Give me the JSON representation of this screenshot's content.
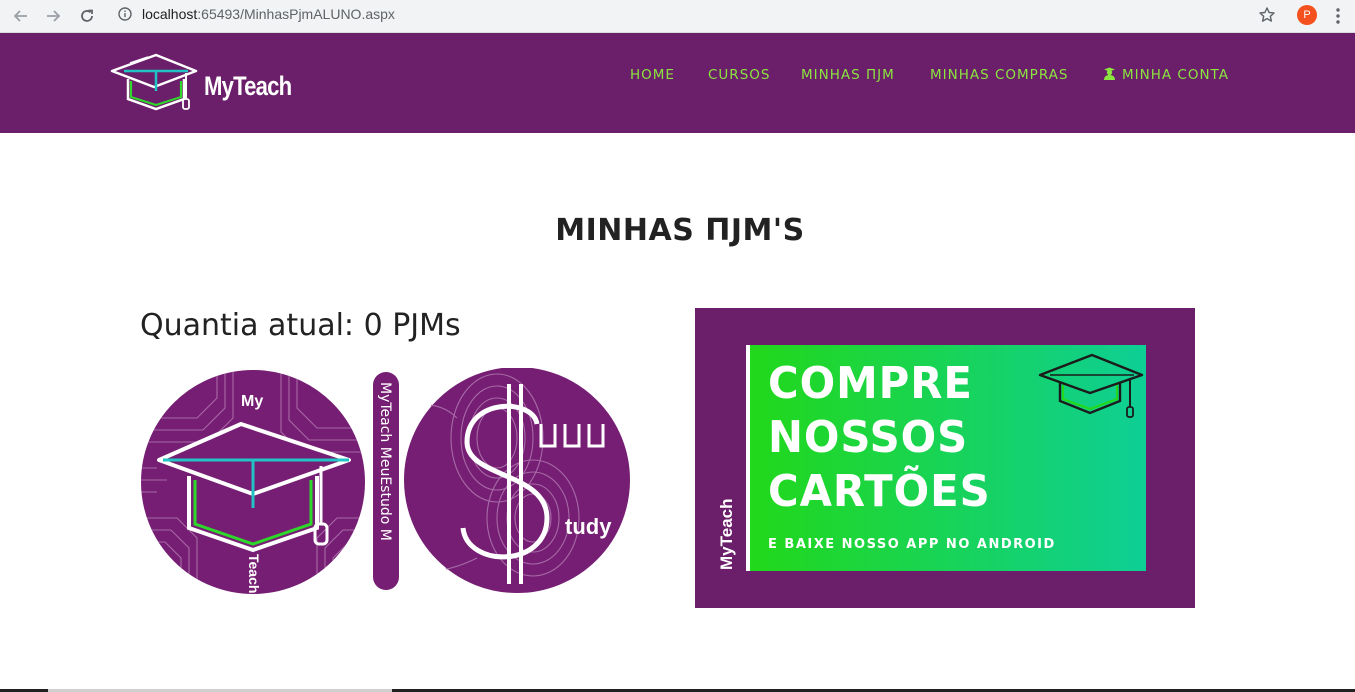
{
  "browser": {
    "url_host": "localhost",
    "url_path": ":65493/MinhasPjmALUNO.aspx",
    "profile_initial": "P",
    "icons": [
      "back-arrow-icon",
      "forward-arrow-icon",
      "reload-icon",
      "info-icon",
      "star-icon",
      "more-vert-icon"
    ]
  },
  "navbar": {
    "logo_text": "MyTeach",
    "links": [
      {
        "label": "HOME"
      },
      {
        "label": "CURSOS"
      },
      {
        "label": "MINHAS ΠJM"
      },
      {
        "label": "MINHAS COMPRAS"
      },
      {
        "label": "MINHA CONTA",
        "icon": "user-graduate-icon"
      }
    ],
    "colors": {
      "background": "#6b1e69",
      "link": "#8be43f"
    }
  },
  "main": {
    "title": "MINHAS ΠJM'S",
    "quantity_text": "Quantia atual: 0 PJMs",
    "coin_logo": {
      "left_text_top": "My",
      "left_text_bottom": "Teach",
      "band_text": "MyTeach MeuEstudo M",
      "right_text": "tudy"
    }
  },
  "banner": {
    "headline_lines": [
      "COMPRE",
      "NOSSOS",
      "CARTÕES"
    ],
    "subline": "E BAIXE NOSSO APP NO ANDROID",
    "vertical_brand": "MyTeach",
    "colors": {
      "frame": "#6b1e69",
      "gradient_start": "#22d81a",
      "gradient_end": "#0ecf95"
    }
  }
}
